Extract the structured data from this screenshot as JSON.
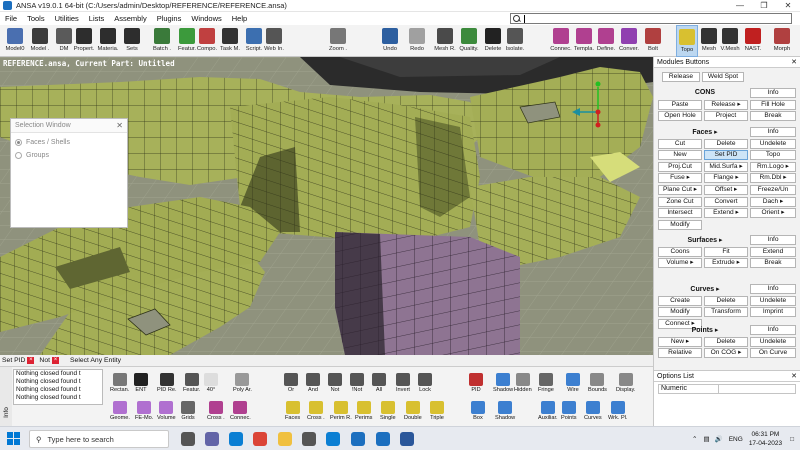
{
  "window": {
    "title": "ANSA v19.0.1 64-bit (C:/Users/admin/Desktop/REFERENCE/REFERENCE.ansa)",
    "controls": [
      "—",
      "❐",
      "✕"
    ]
  },
  "menu": [
    "File",
    "Tools",
    "Utilities",
    "Lists",
    "Assembly",
    "Plugins",
    "Windows",
    "Help"
  ],
  "toolbar": [
    {
      "label": "Model0",
      "icon": "model-icon",
      "color": "#4a6fb0"
    },
    {
      "label": "Model .",
      "icon": "model-browser-icon",
      "color": "#3c3c3c"
    },
    {
      "label": "DM",
      "icon": "data-management-icon",
      "color": "#5a5a5a"
    },
    {
      "label": "Propert.",
      "icon": "properties-icon",
      "color": "#2d2d2d"
    },
    {
      "label": "Materia.",
      "icon": "materials-icon",
      "color": "#2d2d2d"
    },
    {
      "label": "Sets",
      "icon": "sets-icon",
      "color": "#2d2d2d"
    },
    {
      "label": "Batch .",
      "icon": "batch-icon",
      "color": "#3a7a3a"
    },
    {
      "label": "Featur.",
      "icon": "features-icon",
      "color": "#3c9a3c"
    },
    {
      "label": "Compo.",
      "icon": "components-icon",
      "color": "#c04040"
    },
    {
      "label": "Task M.",
      "icon": "task-manager-icon",
      "color": "#333333"
    },
    {
      "label": "Script.",
      "icon": "script-icon",
      "color": "#3c6fb0"
    },
    {
      "label": "Web In.",
      "icon": "web-icon",
      "color": "#555555"
    },
    {
      "label": "Zoom .",
      "icon": "zoom-icon",
      "color": "#777777"
    },
    {
      "label": "Undo",
      "icon": "undo-icon",
      "color": "#2d5fa0"
    },
    {
      "label": "Redo",
      "icon": "redo-icon",
      "color": "#a0a0a0"
    },
    {
      "label": "Mesh R.",
      "icon": "mesh-r-icon",
      "color": "#4a4a4a"
    },
    {
      "label": "Quality.",
      "icon": "quality-icon",
      "color": "#3c8a3c"
    },
    {
      "label": "Delete",
      "icon": "delete-icon",
      "color": "#222222"
    },
    {
      "label": "Isolate.",
      "icon": "isolate-icon",
      "color": "#555555"
    },
    {
      "label": "Connec.",
      "icon": "connections-icon",
      "color": "#b04090"
    },
    {
      "label": "Templa.",
      "icon": "template-icon",
      "color": "#b04090"
    },
    {
      "label": "Define.",
      "icon": "define-icon",
      "color": "#b04090"
    },
    {
      "label": "Conver.",
      "icon": "convert-icon",
      "color": "#9040b0"
    },
    {
      "label": "Bolt",
      "icon": "bolt-icon",
      "color": "#b04040"
    },
    {
      "label": "Topo",
      "icon": "topo-icon",
      "color": "#d8c030"
    },
    {
      "label": "Mesh",
      "icon": "mesh-icon",
      "color": "#333333"
    },
    {
      "label": "V.Mesh",
      "icon": "volume-mesh-icon",
      "color": "#333333"
    },
    {
      "label": "NAST.",
      "icon": "nastran-icon",
      "color": "#c02020"
    },
    {
      "label": "Morph",
      "icon": "morph-icon",
      "color": "#b04040"
    }
  ],
  "viewport": {
    "caption": "REFERENCE.ansa,  Current Part: Untitled"
  },
  "selection_window": {
    "title": "Selection Window",
    "options": [
      "Faces / Shells",
      "Groups"
    ],
    "selected": 0
  },
  "modules": {
    "title": "Modules Buttons",
    "top": [
      "Release",
      "Weld Spot"
    ],
    "sections": [
      {
        "name": "CONS",
        "info": "Info",
        "buttons": [
          "Paste",
          "Release ▸",
          "Fill Hole",
          "Open Hole",
          "Project",
          "Break"
        ]
      },
      {
        "name": "Faces ▸",
        "info": "Info",
        "buttons": [
          "Cut",
          "Delete",
          "Undelete",
          "New",
          "Set PID",
          "Topo",
          "Proj.Cut",
          "Mid.Surfa ▸",
          "Rm.Logo ▸",
          "Fuse ▸",
          "Flange ▸",
          "Rm.Dbl ▸",
          "Plane Cut ▸",
          "Offset ▸",
          "Freeze/Un",
          "Zone Cut",
          "Convert",
          "Dach ▸",
          "Intersect",
          "Extend ▸",
          "Orient ▸",
          "Modify"
        ]
      },
      {
        "name": "Surfaces ▸",
        "info": "Info",
        "buttons": [
          "Coons",
          "Fit",
          "Extend",
          "Volume ▸",
          "Extrude ▸",
          "Break"
        ]
      },
      {
        "name": "Curves ▸",
        "info": "Info",
        "buttons": [
          "Create",
          "Delete",
          "Undelete",
          "Modify",
          "Transform",
          "Imprint",
          "Connect ▸"
        ]
      },
      {
        "name": "Points ▸",
        "info": "Info",
        "buttons": [
          "New ▸",
          "Delete",
          "Undelete",
          "Relative",
          "On COG ▸",
          "On Curve"
        ]
      }
    ],
    "selected_button": "Set PID"
  },
  "status": {
    "tabs": [
      "Set PID",
      "Not"
    ],
    "message": "Select Any Entity"
  },
  "log": [
    "Nothing closed found t",
    "Nothing closed found t",
    "Nothing closed found t",
    "Nothing closed found t"
  ],
  "bottom_tools": [
    {
      "label": "Rectan.",
      "icon": "rectangle-select-icon",
      "color": "#777777"
    },
    {
      "label": "ENT",
      "icon": "entity-icon",
      "color": "#222222"
    },
    {
      "label": "PID Re.",
      "icon": "pid-icon",
      "color": "#333333"
    },
    {
      "label": "Featur.",
      "icon": "feature-icon",
      "color": "#555555"
    },
    {
      "label": "40°",
      "icon": "angle-field-icon",
      "color": "#dddddd"
    },
    {
      "label": "Poly Ar.",
      "icon": "poly-area-icon",
      "color": "#999999"
    },
    {
      "label": "Or",
      "icon": "or-icon",
      "color": "#555555"
    },
    {
      "label": "And",
      "icon": "and-icon",
      "color": "#555555"
    },
    {
      "label": "Not",
      "icon": "not-icon",
      "color": "#555555"
    },
    {
      "label": "!Not",
      "icon": "not-not-icon",
      "color": "#555555"
    },
    {
      "label": "All",
      "icon": "all-icon",
      "color": "#555555"
    },
    {
      "label": "Invert",
      "icon": "invert-icon",
      "color": "#555555"
    },
    {
      "label": "Lock",
      "icon": "lock-icon",
      "color": "#555555"
    },
    {
      "label": "Geome.",
      "icon": "geometry-icon",
      "color": "#b070d0"
    },
    {
      "label": "FE-Mo.",
      "icon": "fe-model-icon",
      "color": "#b070d0"
    },
    {
      "label": "Volume",
      "icon": "volume-icon",
      "color": "#b070d0"
    },
    {
      "label": "Grids",
      "icon": "grids-icon",
      "color": "#666666"
    },
    {
      "label": "Cross .",
      "icon": "cross-section-icon",
      "color": "#b04090"
    },
    {
      "label": "Connec.",
      "icon": "connec-icon",
      "color": "#b04090"
    },
    {
      "label": "Faces",
      "icon": "faces-icon",
      "color": "#d8c030"
    },
    {
      "label": "Cross .",
      "icon": "cross-icon",
      "color": "#d8c030"
    },
    {
      "label": "Perim R.",
      "icon": "perim-r-icon",
      "color": "#d8c030"
    },
    {
      "label": "Perims",
      "icon": "perims-icon",
      "color": "#d8c030"
    },
    {
      "label": "Single",
      "icon": "single-icon",
      "color": "#d8c030"
    },
    {
      "label": "Double",
      "icon": "double-icon",
      "color": "#d8c030"
    },
    {
      "label": "Triple",
      "icon": "triple-icon",
      "color": "#d8c030"
    },
    {
      "label": "PID",
      "icon": "pid-view-icon",
      "color": "#c03030"
    },
    {
      "label": "Shadow",
      "icon": "shadow-icon",
      "color": "#3c7fd0"
    },
    {
      "label": "Hidden",
      "icon": "hidden-icon",
      "color": "#888888"
    },
    {
      "label": "Fringe",
      "icon": "fringe-icon",
      "color": "#666666"
    },
    {
      "label": "Wire",
      "icon": "wire-icon",
      "color": "#3c7fd0"
    },
    {
      "label": "Bounds",
      "icon": "bounds-icon",
      "color": "#888888"
    },
    {
      "label": "Display.",
      "icon": "display-icon",
      "color": "#888888"
    },
    {
      "label": "Box",
      "icon": "box-icon",
      "color": "#3c7fd0"
    },
    {
      "label": "Shadow",
      "icon": "shadow2-icon",
      "color": "#3c7fd0"
    },
    {
      "label": "Auxiliar.",
      "icon": "auxiliary-icon",
      "color": "#3c7fd0"
    },
    {
      "label": "Points",
      "icon": "points-icon",
      "color": "#3c7fd0"
    },
    {
      "label": "Curves",
      "icon": "curves-icon",
      "color": "#3c7fd0"
    },
    {
      "label": "Wrk. Pl.",
      "icon": "work-plane-icon",
      "color": "#3c7fd0"
    }
  ],
  "options_list": {
    "title": "Options List",
    "row": [
      "Numeric",
      ""
    ]
  },
  "taskbar": {
    "search_placeholder": "Type here to search",
    "apps": [
      {
        "icon": "task-view-icon",
        "color": "#555555"
      },
      {
        "icon": "teams-icon",
        "color": "#6264a7"
      },
      {
        "icon": "edge-icon",
        "color": "#0b7fd3"
      },
      {
        "icon": "chrome-icon",
        "color": "#db4437"
      },
      {
        "icon": "file-explorer-icon",
        "color": "#f0c040"
      },
      {
        "icon": "settings-icon",
        "color": "#555555"
      },
      {
        "icon": "store-icon",
        "color": "#0b7fd3"
      },
      {
        "icon": "ansa-icon",
        "color": "#1c6fbf"
      },
      {
        "icon": "meta-icon",
        "color": "#1c6fbf"
      },
      {
        "icon": "word-icon",
        "color": "#2b579a"
      }
    ],
    "lang": "ENG",
    "time": "06:31 PM",
    "date": "17-04-2023"
  },
  "colors": {
    "mesh": "#a9b35a",
    "mesh_dark": "#6c7536",
    "pid_purple": "#8e7492",
    "background": "#8f927d"
  }
}
